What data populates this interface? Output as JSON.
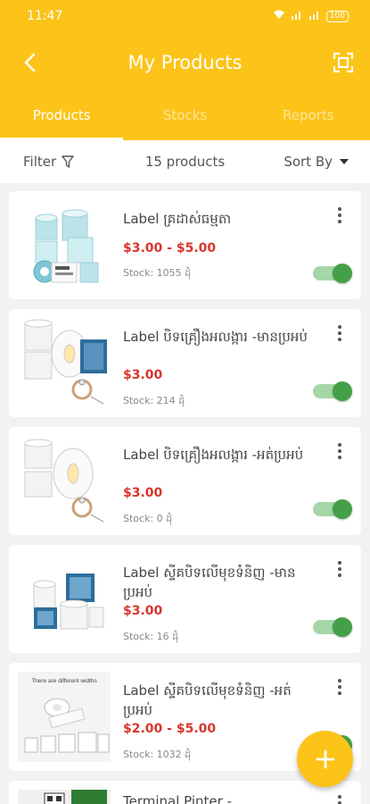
{
  "status": {
    "time": "11:47",
    "battery": "100"
  },
  "header": {
    "title": "My Products"
  },
  "tabs": [
    "Products",
    "Stocks",
    "Reports"
  ],
  "filterbar": {
    "filter_label": "Filter",
    "count": "15 products",
    "sort_label": "Sort By"
  },
  "products": [
    {
      "name": "Label គ្រដាស់ធម្មតា",
      "price": "$3.00 - $5.00",
      "stock": "Stock: 1055 ដុំ",
      "enabled": true
    },
    {
      "name": "Label បិទគ្រឿងអលង្ការ -មានប្រអប់",
      "price": "$3.00",
      "stock": "Stock: 214 ដុំ",
      "enabled": true
    },
    {
      "name": "Label បិទគ្រឿងអលង្ការ -អត់ប្រអប់",
      "price": "$3.00",
      "stock": "Stock: 0 ដុំ",
      "enabled": true
    },
    {
      "name": "Label ស្ទីគបិទលើមុខទំនិញ -មានប្រអប់",
      "price": "$3.00",
      "stock": "Stock: 16 ដុំ",
      "enabled": true
    },
    {
      "name": "Label ស្ទីគបិទលើមុខទំនិញ -អត់ប្រអប់",
      "price": "$2.00 - $5.00",
      "stock": "Stock: 1032 ដុំ",
      "enabled": true
    },
    {
      "name": "Terminal Pinter -",
      "price": "",
      "stock": "",
      "enabled": true
    }
  ],
  "thumb_texts": {
    "product5": "There are different widths"
  },
  "colors": {
    "primary": "#fcc419",
    "price": "#d9352b",
    "toggle_on": "#43a047"
  }
}
